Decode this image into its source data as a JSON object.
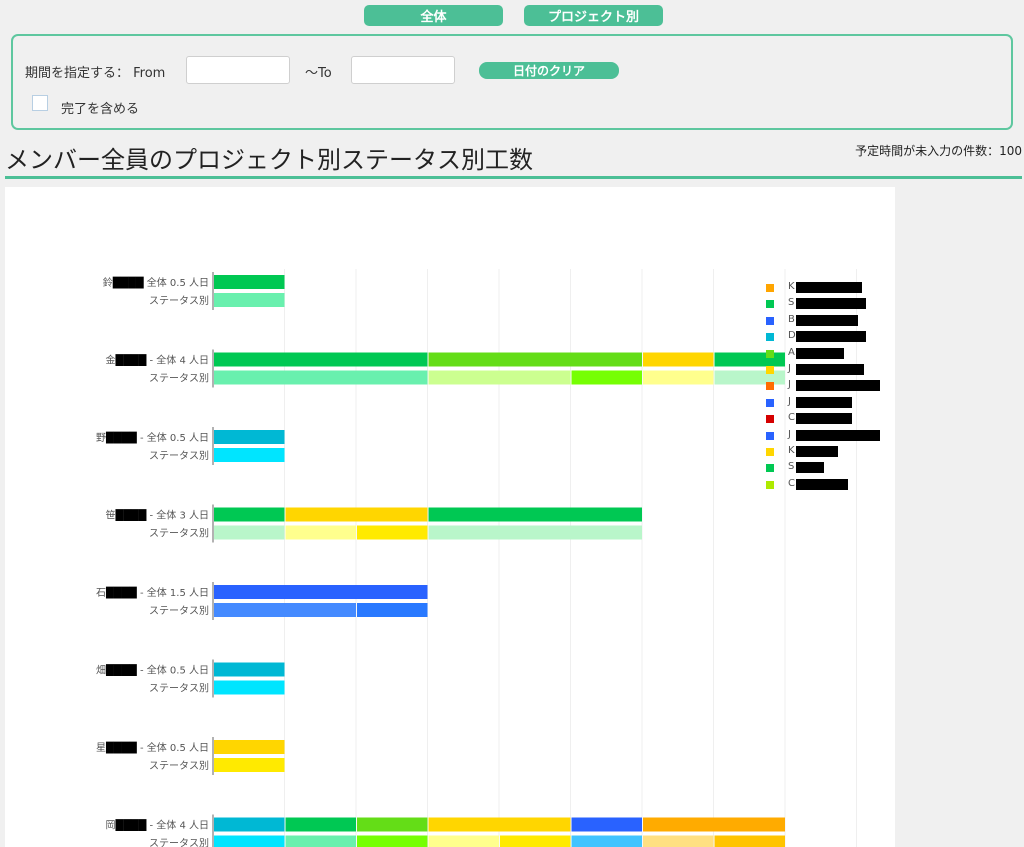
{
  "tabs": {
    "all_label": "全体",
    "by_project_label": "プロジェクト別"
  },
  "filter": {
    "period_label": "期間を指定する： From",
    "from_value": "",
    "to_label": "～To",
    "to_value": "",
    "clear_label": "日付のクリア",
    "include_done_label": "完了を含める",
    "include_done_checked": false
  },
  "page": {
    "title": "メンバー全員のプロジェクト別ステータス別工数",
    "unentered_label": "予定時間が未入力の件数：100"
  },
  "legend": [
    {
      "label": "K",
      "color": "#ffa500"
    },
    {
      "label": "S",
      "color": "#00c853"
    },
    {
      "label": "B",
      "color": "#2962ff"
    },
    {
      "label": "D",
      "color": "#00b8d4"
    },
    {
      "label": "A",
      "color": "#64dd17"
    },
    {
      "label": "J",
      "color": "#ffd600"
    },
    {
      "label": "J",
      "color": "#ff6d00"
    },
    {
      "label": "J",
      "color": "#2962ff"
    },
    {
      "label": "C",
      "color": "#d50000"
    },
    {
      "label": "J",
      "color": "#2962ff"
    },
    {
      "label": "K",
      "color": "#ffd600"
    },
    {
      "label": "S",
      "color": "#00c853"
    },
    {
      "label": "C",
      "color": "#aeea00"
    }
  ],
  "chart_data": {
    "type": "bar",
    "orientation": "horizontal",
    "stacked": true,
    "unit": "人日",
    "status_row_label": "ステータス別",
    "xlim": [
      0,
      7
    ],
    "grid": true,
    "members": [
      {
        "name": "鈴",
        "total_label": "全体 0.5 人日",
        "total": 0.5,
        "projects": [
          {
            "value": 0.5,
            "color": "#00c853"
          }
        ],
        "statuses": [
          {
            "value": 0.5,
            "color": "#69f0ae"
          }
        ]
      },
      {
        "name": "金",
        "total_label": "- 全体 4 人日",
        "total": 4,
        "projects": [
          {
            "value": 1.5,
            "color": "#00c853"
          },
          {
            "value": 1.5,
            "color": "#64dd17"
          },
          {
            "value": 0.5,
            "color": "#ffd600"
          },
          {
            "value": 0.5,
            "color": "#00c853"
          }
        ],
        "statuses": [
          {
            "value": 1.5,
            "color": "#69f0ae"
          },
          {
            "value": 1.0,
            "color": "#ccff90"
          },
          {
            "value": 0.5,
            "color": "#76ff03"
          },
          {
            "value": 0.5,
            "color": "#ffff8d"
          },
          {
            "value": 0.5,
            "color": "#b9f6ca"
          }
        ]
      },
      {
        "name": "野",
        "total_label": "- 全体 0.5 人日",
        "total": 0.5,
        "projects": [
          {
            "value": 0.5,
            "color": "#00b8d4"
          }
        ],
        "statuses": [
          {
            "value": 0.5,
            "color": "#00e5ff"
          }
        ]
      },
      {
        "name": "笹",
        "total_label": "- 全体 3 人日",
        "total": 3,
        "projects": [
          {
            "value": 0.5,
            "color": "#00c853"
          },
          {
            "value": 1.0,
            "color": "#ffd600"
          },
          {
            "value": 1.5,
            "color": "#00c853"
          }
        ],
        "statuses": [
          {
            "value": 0.5,
            "color": "#b9f6ca"
          },
          {
            "value": 0.5,
            "color": "#ffff8d"
          },
          {
            "value": 0.5,
            "color": "#ffea00"
          },
          {
            "value": 1.5,
            "color": "#b9f6ca"
          }
        ]
      },
      {
        "name": "石",
        "total_label": "- 全体 1.5 人日",
        "total": 1.5,
        "projects": [
          {
            "value": 1.5,
            "color": "#2962ff"
          }
        ],
        "statuses": [
          {
            "value": 1.0,
            "color": "#448aff"
          },
          {
            "value": 0.5,
            "color": "#2979ff"
          }
        ]
      },
      {
        "name": "畑",
        "total_label": "- 全体 0.5 人日",
        "total": 0.5,
        "projects": [
          {
            "value": 0.5,
            "color": "#00b8d4"
          }
        ],
        "statuses": [
          {
            "value": 0.5,
            "color": "#00e5ff"
          }
        ]
      },
      {
        "name": "星",
        "total_label": "- 全体 0.5 人日",
        "total": 0.5,
        "projects": [
          {
            "value": 0.5,
            "color": "#ffd600"
          }
        ],
        "statuses": [
          {
            "value": 0.5,
            "color": "#ffea00"
          }
        ]
      },
      {
        "name": "岡",
        "total_label": "- 全体 4 人日",
        "total": 4,
        "projects": [
          {
            "value": 0.5,
            "color": "#00b8d4"
          },
          {
            "value": 0.5,
            "color": "#00c853"
          },
          {
            "value": 0.5,
            "color": "#64dd17"
          },
          {
            "value": 1.0,
            "color": "#ffd600"
          },
          {
            "value": 0.5,
            "color": "#2962ff"
          },
          {
            "value": 1.0,
            "color": "#ffab00"
          }
        ],
        "statuses": [
          {
            "value": 0.5,
            "color": "#00e5ff"
          },
          {
            "value": 0.5,
            "color": "#69f0ae"
          },
          {
            "value": 0.5,
            "color": "#76ff03"
          },
          {
            "value": 0.5,
            "color": "#ffff8d"
          },
          {
            "value": 0.5,
            "color": "#ffea00"
          },
          {
            "value": 0.5,
            "color": "#40c4ff"
          },
          {
            "value": 0.5,
            "color": "#ffe082"
          },
          {
            "value": 0.5,
            "color": "#ffc400"
          }
        ]
      }
    ]
  }
}
